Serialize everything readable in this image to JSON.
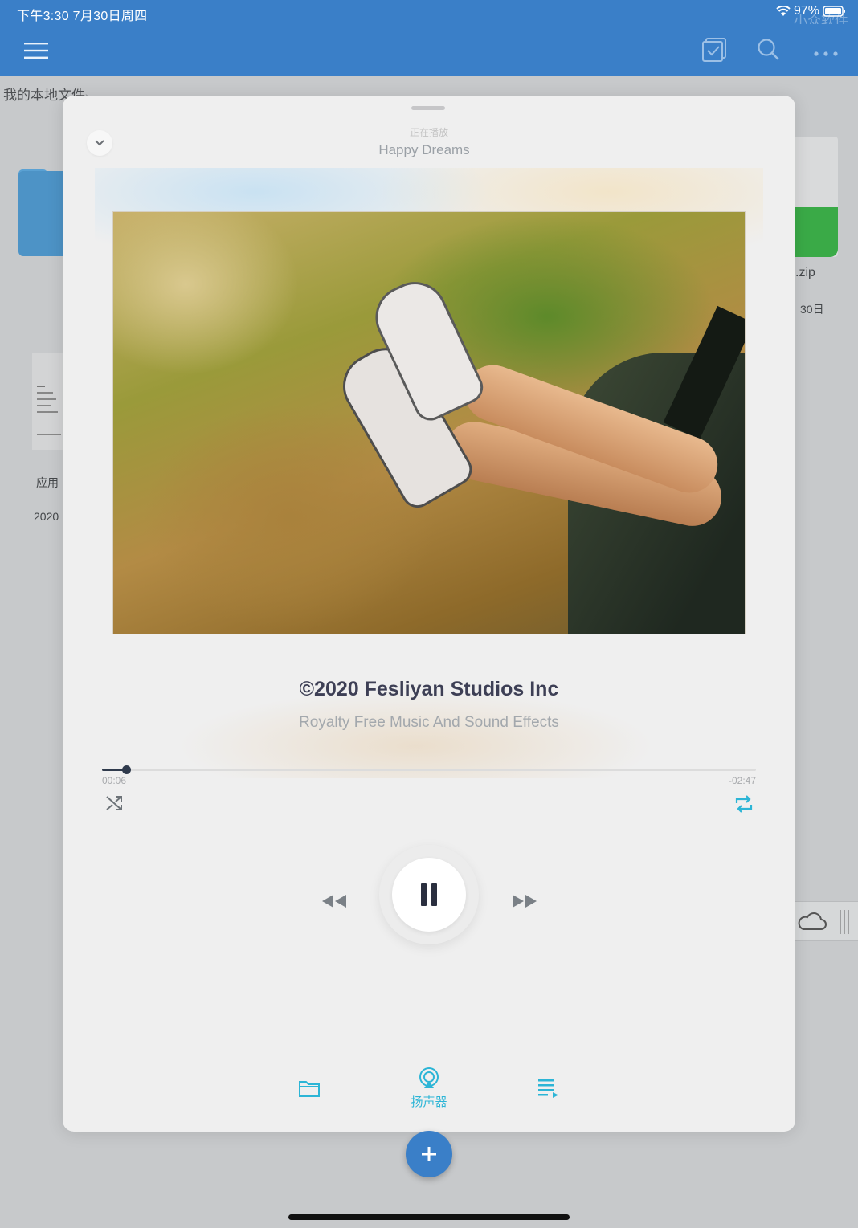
{
  "status_bar": {
    "time_date": "下午3:30  7月30日周四",
    "battery": "97%",
    "watermark": "小众软件"
  },
  "background": {
    "breadcrumb": "我的本地文件",
    "breadcrumb_chevron": "›",
    "items": [
      {
        "label": "应用",
        "meta": "2020"
      },
      {
        "label": ".zip",
        "meta": "30日"
      }
    ]
  },
  "player": {
    "now_playing_label": "正在播放",
    "track_title": "Happy Dreams",
    "artist": "©2020 Fesliyan Studios Inc",
    "subtitle": "Royalty Free Music And Sound Effects",
    "time_elapsed": "00:06",
    "time_remaining": "-02:47",
    "progress": 0.037,
    "speaker_label": "扬声器"
  },
  "colors": {
    "app_blue": "#3a7fc8",
    "accent_cyan": "#2cb5d6",
    "title_dark": "#3d3f55"
  },
  "icons": {
    "menu": "hamburger-icon",
    "select": "checkbox-icon",
    "search": "search-icon",
    "more": "more-icon",
    "collapse": "chevron-down-icon",
    "shuffle": "shuffle-icon",
    "repeat": "repeat-icon",
    "rewind": "rewind-icon",
    "pause": "pause-icon",
    "forward": "fast-forward-icon",
    "files": "folder-icon",
    "airplay": "airplay-icon",
    "queue": "playlist-icon",
    "add": "plus-icon"
  }
}
